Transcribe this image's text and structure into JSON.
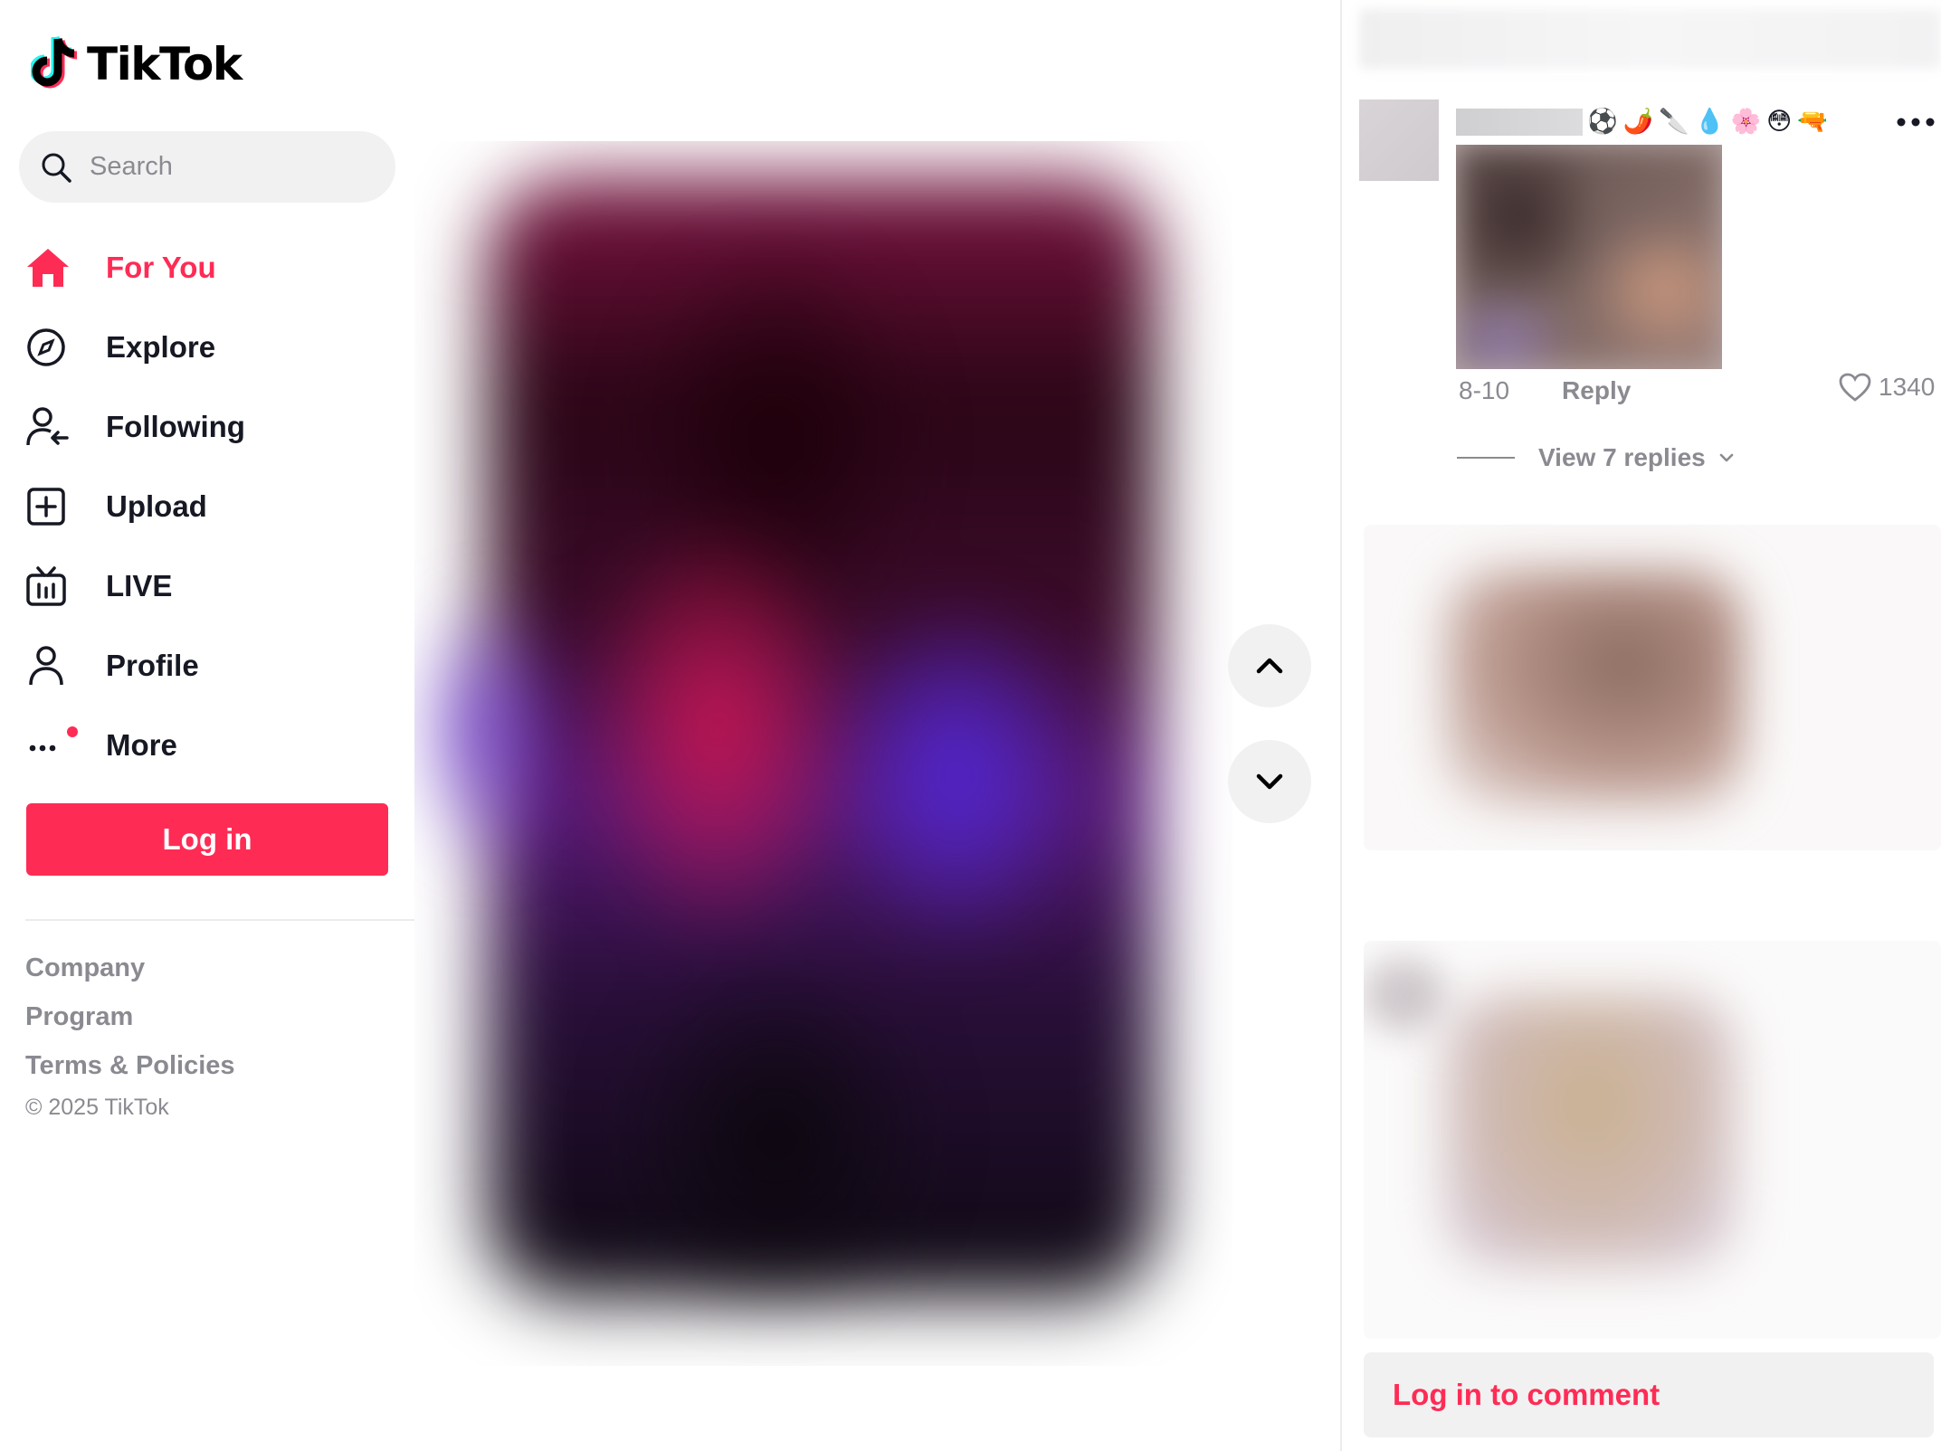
{
  "brand": {
    "name": "TikTok",
    "accent": "#fe2c55"
  },
  "search": {
    "placeholder": "Search"
  },
  "nav": [
    {
      "label": "For You",
      "icon": "home-icon",
      "active": true
    },
    {
      "label": "Explore",
      "icon": "compass-icon"
    },
    {
      "label": "Following",
      "icon": "following-icon"
    },
    {
      "label": "Upload",
      "icon": "upload-icon"
    },
    {
      "label": "LIVE",
      "icon": "live-tv-icon"
    },
    {
      "label": "Profile",
      "icon": "profile-icon"
    },
    {
      "label": "More",
      "icon": "more-icon"
    }
  ],
  "login": {
    "label": "Log in"
  },
  "footer": {
    "links": [
      "Company",
      "Program",
      "Terms & Policies"
    ],
    "copyright": "© 2025 TikTok"
  },
  "comments": {
    "first": {
      "emojis": "⚽🌶️🔪💧🌸😳🔫",
      "date": "8-10",
      "reply_label": "Reply",
      "likes": "1340",
      "view_replies": "View 7 replies"
    },
    "login_prompt": "Log in to comment"
  }
}
